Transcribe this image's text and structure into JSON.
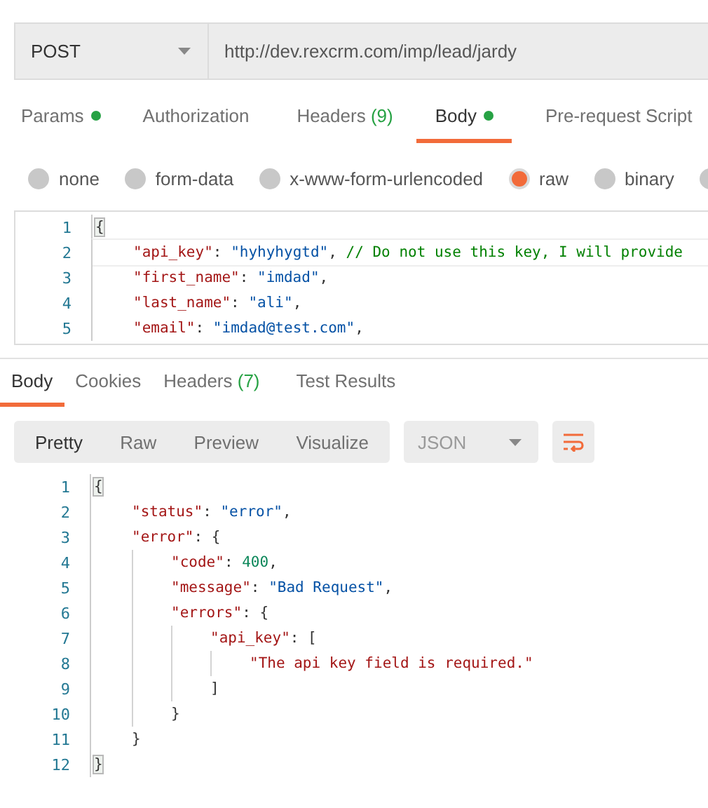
{
  "request": {
    "method": "POST",
    "url": "http://dev.rexcrm.com/imp/lead/jardy"
  },
  "request_tabs": [
    {
      "label": "Params",
      "dot": true,
      "selected": false
    },
    {
      "label": "Authorization",
      "dot": false,
      "selected": false
    },
    {
      "label": "Headers",
      "count": "(9)",
      "dot": false,
      "selected": false
    },
    {
      "label": "Body",
      "dot": true,
      "selected": true
    },
    {
      "label": "Pre-request Script",
      "dot": false,
      "selected": false
    }
  ],
  "body_types": [
    {
      "label": "none",
      "selected": false
    },
    {
      "label": "form-data",
      "selected": false
    },
    {
      "label": "x-www-form-urlencoded",
      "selected": false
    },
    {
      "label": "raw",
      "selected": true
    },
    {
      "label": "binary",
      "selected": false
    },
    {
      "selected": false
    }
  ],
  "request_body": [
    {
      "number": "1",
      "matched": true,
      "tokens": [
        {
          "kind": "punct",
          "text": "{"
        }
      ],
      "children": [
        {
          "number": "2",
          "active": true,
          "tokens": [
            {
              "kind": "key",
              "text": "\"api_key\""
            },
            {
              "kind": "punct",
              "text": ": "
            },
            {
              "kind": "string",
              "text": "\"hyhyhygtd\""
            },
            {
              "kind": "punct",
              "text": ", "
            },
            {
              "kind": "comment",
              "text": "// Do not use this key, I will provide"
            }
          ]
        },
        {
          "number": "3",
          "tokens": [
            {
              "kind": "key",
              "text": "\"first_name\""
            },
            {
              "kind": "punct",
              "text": ": "
            },
            {
              "kind": "string",
              "text": "\"imdad\""
            },
            {
              "kind": "punct",
              "text": ","
            }
          ]
        },
        {
          "number": "4",
          "tokens": [
            {
              "kind": "key",
              "text": "\"last_name\""
            },
            {
              "kind": "punct",
              "text": ": "
            },
            {
              "kind": "string",
              "text": "\"ali\""
            },
            {
              "kind": "punct",
              "text": ","
            }
          ]
        },
        {
          "number": "5",
          "tokens": [
            {
              "kind": "key",
              "text": "\"email\""
            },
            {
              "kind": "punct",
              "text": ": "
            },
            {
              "kind": "string",
              "text": "\"imdad@test.com\""
            },
            {
              "kind": "punct",
              "text": ","
            }
          ]
        }
      ]
    }
  ],
  "response_tabs": [
    {
      "label": "Body",
      "selected": true
    },
    {
      "label": "Cookies",
      "selected": false
    },
    {
      "label": "Headers",
      "count": "(7)",
      "selected": false
    },
    {
      "label": "Test Results",
      "selected": false
    }
  ],
  "view_modes": [
    {
      "label": "Pretty",
      "selected": true
    },
    {
      "label": "Raw",
      "selected": false
    },
    {
      "label": "Preview",
      "selected": false
    },
    {
      "label": "Visualize",
      "selected": false
    }
  ],
  "format": "JSON",
  "response_body": [
    {
      "number": "1",
      "matched": true,
      "tokens": [
        {
          "kind": "punct",
          "text": "{"
        }
      ],
      "children": [
        {
          "number": "2",
          "tokens": [
            {
              "kind": "key",
              "text": "\"status\""
            },
            {
              "kind": "punct",
              "text": ": "
            },
            {
              "kind": "value",
              "text": "\"error\""
            },
            {
              "kind": "punct",
              "text": ","
            }
          ]
        },
        {
          "number": "3",
          "tokens": [
            {
              "kind": "key",
              "text": "\"error\""
            },
            {
              "kind": "punct",
              "text": ": {"
            }
          ],
          "children": [
            {
              "number": "4",
              "tokens": [
                {
                  "kind": "key",
                  "text": "\"code\""
                },
                {
                  "kind": "punct",
                  "text": ": "
                },
                {
                  "kind": "number",
                  "text": "400"
                },
                {
                  "kind": "punct",
                  "text": ","
                }
              ]
            },
            {
              "number": "5",
              "tokens": [
                {
                  "kind": "key",
                  "text": "\"message\""
                },
                {
                  "kind": "punct",
                  "text": ": "
                },
                {
                  "kind": "value",
                  "text": "\"Bad Request\""
                },
                {
                  "kind": "punct",
                  "text": ","
                }
              ]
            },
            {
              "number": "6",
              "tokens": [
                {
                  "kind": "key",
                  "text": "\"errors\""
                },
                {
                  "kind": "punct",
                  "text": ": {"
                }
              ],
              "children": [
                {
                  "number": "7",
                  "tokens": [
                    {
                      "kind": "key",
                      "text": "\"api_key\""
                    },
                    {
                      "kind": "punct",
                      "text": ": ["
                    }
                  ],
                  "children": [
                    {
                      "number": "8",
                      "tokens": [
                        {
                          "kind": "key",
                          "text": "\"The api key field is required.\""
                        }
                      ]
                    }
                  ],
                  "closing": {
                    "number": "9",
                    "tokens": [
                      {
                        "kind": "punct",
                        "text": "]"
                      }
                    ]
                  }
                }
              ],
              "closing": {
                "number": "10",
                "tokens": [
                  {
                    "kind": "punct",
                    "text": "}"
                  }
                ]
              }
            }
          ],
          "closing": {
            "number": "11",
            "tokens": [
              {
                "kind": "punct",
                "text": "}"
              }
            ]
          }
        }
      ],
      "closing": {
        "number": "12",
        "matched": true,
        "tokens": [
          {
            "kind": "punct",
            "text": "}"
          }
        ]
      }
    }
  ]
}
